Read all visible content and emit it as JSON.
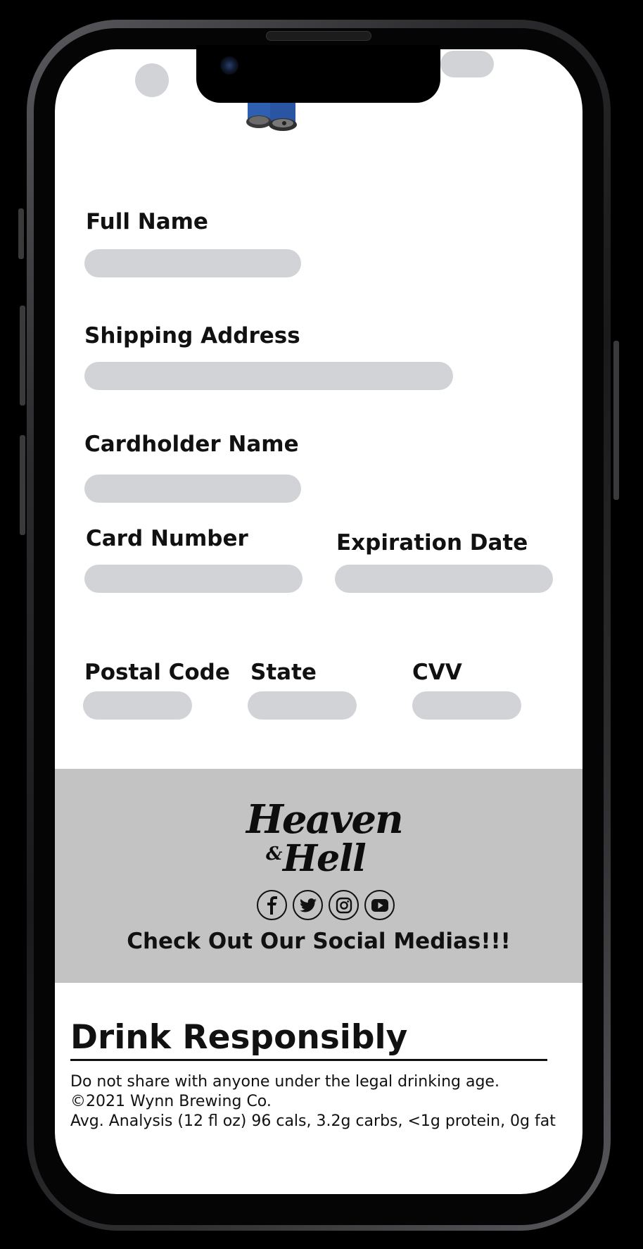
{
  "form": {
    "full_name": {
      "label": "Full Name",
      "value": ""
    },
    "shipping_address": {
      "label": "Shipping Address",
      "value": ""
    },
    "cardholder_name": {
      "label": "Cardholder Name",
      "value": ""
    },
    "card_number": {
      "label": "Card Number",
      "value": ""
    },
    "expiration_date": {
      "label": "Expiration Date",
      "value": ""
    },
    "postal_code": {
      "label": "Postal Code",
      "value": ""
    },
    "state": {
      "label": "State",
      "value": ""
    },
    "cvv": {
      "label": "CVV",
      "value": ""
    }
  },
  "footer": {
    "brand": {
      "line1": "Heaven",
      "amp": "&",
      "line2": "Hell"
    },
    "social": {
      "icons": [
        "facebook-icon",
        "twitter-icon",
        "instagram-icon",
        "youtube-icon"
      ],
      "caption": "Check Out Our Social Medias!!!"
    },
    "responsibility": {
      "title": "Drink Responsibly",
      "lines": [
        "Do not share with anyone under the legal drinking age.",
        "©2021 Wynn Brewing Co.",
        "Avg. Analysis (12 fl oz) 96 cals, 3.2g carbs, <1g protein, 0g fat"
      ]
    }
  },
  "colors": {
    "input_fill": "#d1d3d7",
    "footer_band": "#c3c3c3",
    "text": "#111111",
    "product_can": "#2f5fb0"
  }
}
